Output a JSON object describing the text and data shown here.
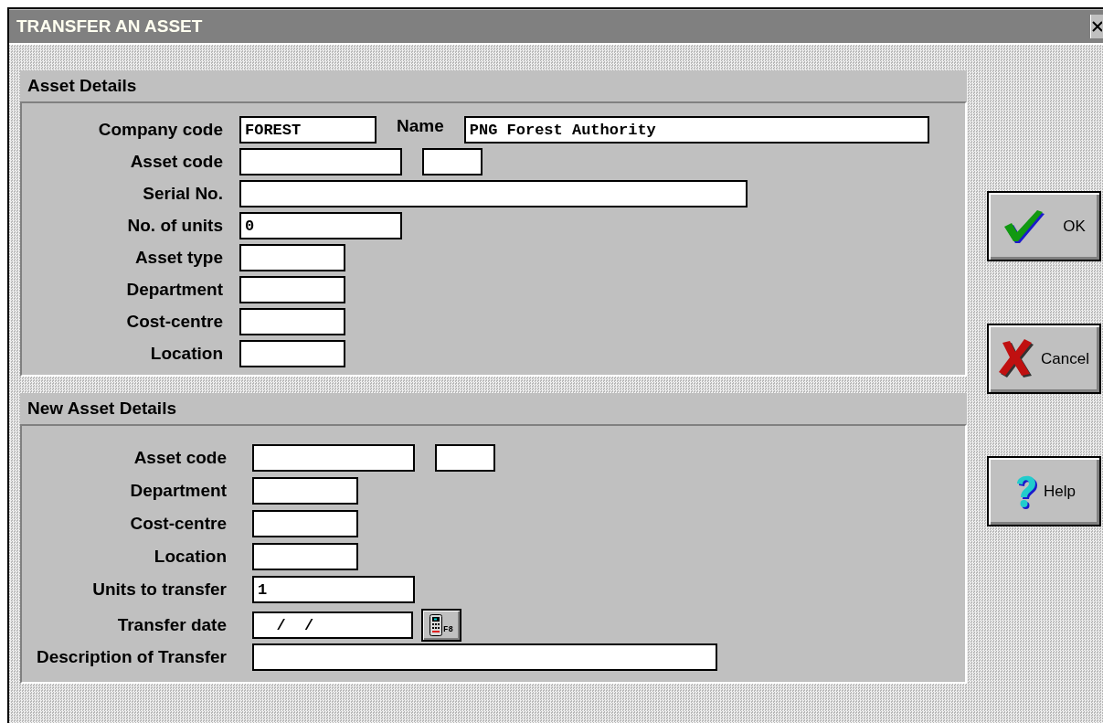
{
  "window": {
    "title": "TRANSFER AN ASSET"
  },
  "sections": [
    {
      "title": "Asset Details",
      "rows": [
        {
          "label": "Company code",
          "fields": [
            {
              "kind": "short",
              "value": "FOREST"
            },
            {
              "kind": "caption",
              "text": "Name"
            },
            {
              "kind": "full",
              "value": "PNG Forest Authority"
            }
          ]
        },
        {
          "label": "Asset code",
          "fields": [
            {
              "kind": "medium"
            },
            {
              "kind": "tiny"
            }
          ]
        },
        {
          "label": "Serial No.",
          "fields": [
            {
              "kind": "wide"
            }
          ]
        },
        {
          "label": "No. of units",
          "fields": [
            {
              "kind": "medium",
              "value": "0"
            }
          ]
        },
        {
          "label": "Asset type",
          "fields": [
            {
              "kind": "small"
            }
          ]
        },
        {
          "label": "Department",
          "fields": [
            {
              "kind": "small"
            }
          ]
        },
        {
          "label": "Cost-centre",
          "fields": [
            {
              "kind": "small"
            }
          ]
        },
        {
          "label": "Location",
          "fields": [
            {
              "kind": "small"
            }
          ]
        }
      ]
    },
    {
      "title": "New Asset Details",
      "rows": [
        {
          "label": "Asset code",
          "fields": [
            {
              "kind": "medium"
            },
            {
              "kind": "tiny"
            }
          ]
        },
        {
          "label": "Department",
          "fields": [
            {
              "kind": "small"
            }
          ]
        },
        {
          "label": "Cost-centre",
          "fields": [
            {
              "kind": "small"
            }
          ]
        },
        {
          "label": "Location",
          "fields": [
            {
              "kind": "small"
            }
          ]
        },
        {
          "label": "Units to transfer",
          "fields": [
            {
              "kind": "medium",
              "value": "1"
            }
          ]
        },
        {
          "label": "Transfer date",
          "fields": [
            {
              "kind": "date",
              "value": "  /  /"
            },
            {
              "kind": "calendar",
              "hotkey": "F8"
            }
          ]
        },
        {
          "label": "Description of Transfer",
          "fields": [
            {
              "kind": "full"
            }
          ]
        }
      ]
    }
  ],
  "buttons": [
    {
      "kind": "ok",
      "label": "OK"
    },
    {
      "kind": "cancel",
      "label": "Cancel"
    },
    {
      "kind": "help",
      "label": "Help"
    }
  ]
}
